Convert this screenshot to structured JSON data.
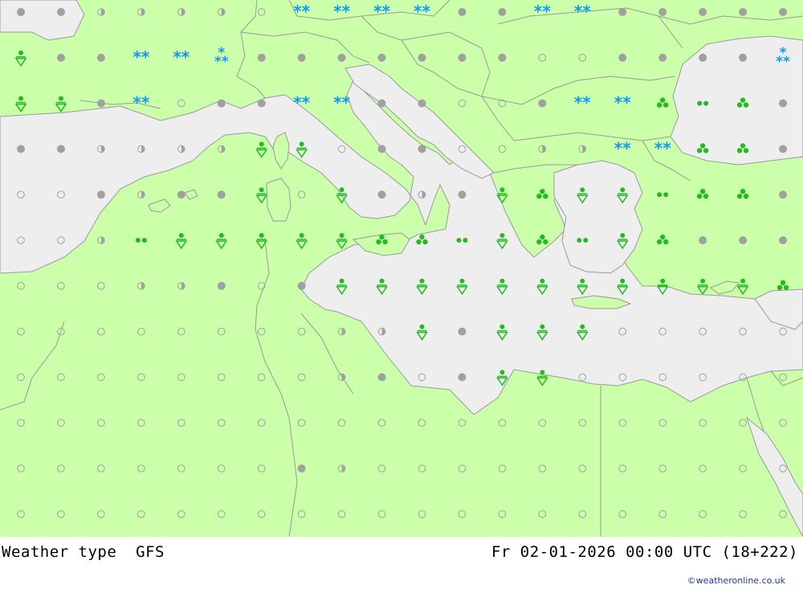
{
  "header": {
    "map_title": "Weather type",
    "model": "GFS",
    "valid_time": "Fr 02-01-2026 00:00 UTC (18+222)",
    "credit": "©weatheronline.co.uk"
  },
  "colors": {
    "land": "#ccffaa",
    "sea": "#eeeeee",
    "border": "#999999",
    "dry": "#a0a0a0",
    "rain": "#22bb22",
    "snow": "#1199ee"
  },
  "legend_symbols": {
    "O": "clear-icon",
    "H": "half-cloud-icon",
    "C": "cloudy-icon",
    "S": "snow-icon",
    "s": "snow-shower-icon",
    "R": "rain-shower-icon",
    "D": "drizzle-icon",
    "T": "heavy-rain-icon"
  },
  "grid": {
    "columns": 20,
    "rows": 12,
    "symbols": [
      "CCHHHHOSSSSCCSSCCCCC",
      "RCCSSsCCCCCCCOOCCCCs",
      "RRCSOCCSSCCOOCSSTDTC",
      "CCHHHHRROCCOOHHSSTTC",
      "OOCHCCRORCHCRTRRDTTC",
      "OOHDRRRRRTTDRTDRTCCC",
      "OOOHHCOCRRRRRRRRRRRT",
      "OOOOOOOOHHRCRRROOOOO",
      "OOOOOOOOHCOCRROOOOOO",
      "OOOOOOOOOOOOOOOOOOOO",
      "OOOOOOOCHOOOOOOOOOOO",
      "OOOOOOOOOOOOOOOOOOOO"
    ]
  }
}
